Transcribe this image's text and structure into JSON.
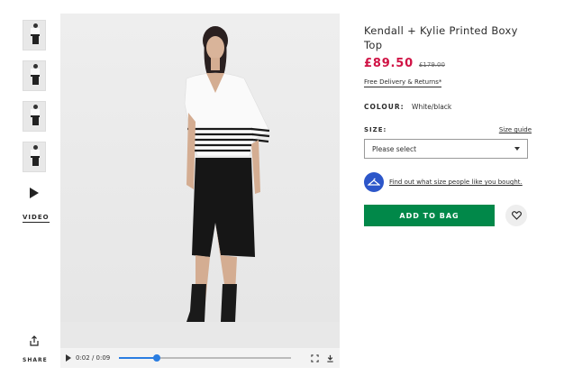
{
  "thumbnails": [
    {
      "alt": "thumbnail-1"
    },
    {
      "alt": "thumbnail-2"
    },
    {
      "alt": "thumbnail-3"
    },
    {
      "alt": "thumbnail-4"
    }
  ],
  "video_label": "VIDEO",
  "share_label": "SHARE",
  "player": {
    "time": "0:02 / 0:09",
    "progress": 0.22,
    "accent": "#2a7de1"
  },
  "product": {
    "title": "Kendall + Kylie Printed Boxy Top",
    "price": "£89.50",
    "was_price": "£179.00",
    "delivery": "Free Delivery & Returns*",
    "colour_label": "COLOUR:",
    "colour_value": "White/black",
    "size_label": "SIZE:",
    "size_guide": "Size guide",
    "size_select": "Please select",
    "fit_link": "Find out what size people like you bought.",
    "add_to_bag": "ADD TO BAG"
  },
  "colors": {
    "price": "#d01345",
    "add_button": "#018849",
    "fit_badge": "#2c56c9"
  }
}
